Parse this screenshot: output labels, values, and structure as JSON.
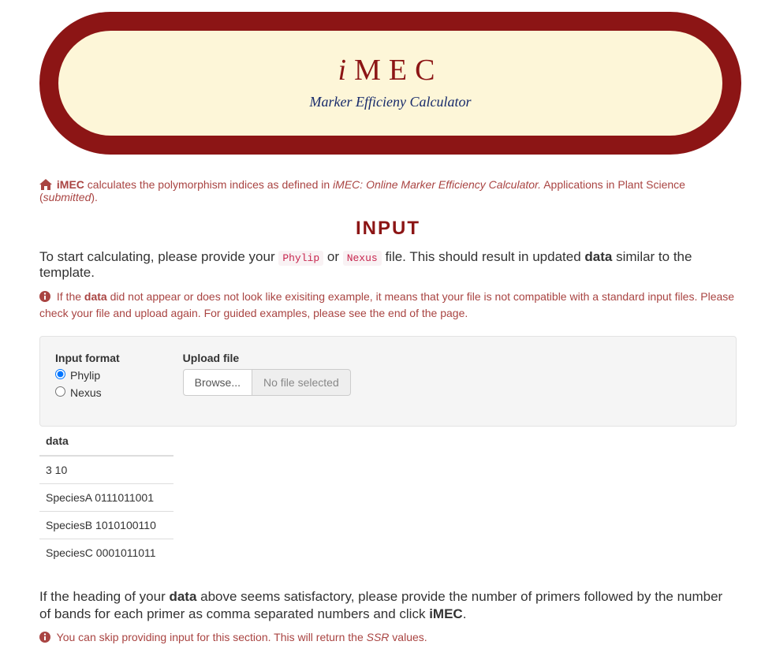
{
  "header": {
    "title_prefix": "i",
    "title_rest": "MEC",
    "subtitle": "Marker Efficieny Calculator"
  },
  "intro": {
    "app_name": "iMEC",
    "text1": " calculates the polymorphism indices as defined in ",
    "citation": "iMEC: Online Marker Efficiency Calculator.",
    "text2": " Applications in Plant Science (",
    "submitted": "submitted",
    "text3": ")."
  },
  "input_section": {
    "heading": "INPUT",
    "start_prefix": "To start calculating, please provide your ",
    "format1": "Phylip",
    "or": " or ",
    "format2": "Nexus",
    "start_mid": " file. This should result in updated ",
    "data_word": "data",
    "start_suffix": " similar to the template.",
    "alert_prefix": "If the ",
    "alert_data": "data",
    "alert_text": " did not appear or does not look like exisiting example, it means that your file is not compatible with a standard input files. Please check your file and upload again. For guided examples, please see the end of the page."
  },
  "form": {
    "format_label": "Input format",
    "radio1": "Phylip",
    "radio2": "Nexus",
    "upload_label": "Upload file",
    "browse_btn": "Browse...",
    "no_file": "No file selected"
  },
  "data_table": {
    "header": "data",
    "rows": [
      "3 10",
      "SpeciesA 0111011001",
      "SpeciesB 1010100110",
      "SpeciesC 0001011011"
    ]
  },
  "primer_para": {
    "prefix": "If the heading of your ",
    "data_word": "data",
    "mid": " above seems satisfactory, please provide the number of primers followed by the number of bands for each primer as comma separated numbers and click ",
    "imec": "iMEC",
    "suffix": "."
  },
  "skip_alert": {
    "prefix": "You can skip providing input for this section. This will return the ",
    "ssr": "SSR",
    "suffix": " values."
  }
}
